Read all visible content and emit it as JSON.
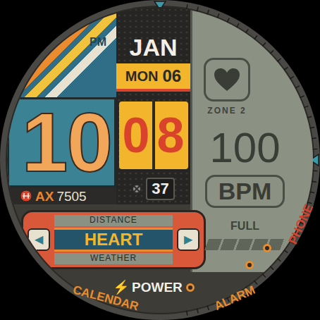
{
  "time": {
    "hours": "10",
    "minutes": "08",
    "seconds": "37",
    "period": "PM"
  },
  "date": {
    "month": "JAN",
    "weekday": "MON",
    "day": "06"
  },
  "brand": {
    "prefix": "AX",
    "model": "7505"
  },
  "heart_rate": {
    "zone": "ZONE 2",
    "value": "100",
    "unit": "BPM"
  },
  "battery": {
    "label": "FULL",
    "level": 1
  },
  "selector": {
    "prev": "◀",
    "next": "▶",
    "items": [
      {
        "label": "DISTANCE",
        "selected": false
      },
      {
        "label": "HEART",
        "selected": true
      },
      {
        "label": "WEATHER",
        "selected": false
      }
    ]
  },
  "power": {
    "icon": "⚡",
    "label": "POWER"
  },
  "shortcuts": [
    {
      "label": "CALENDAR",
      "color": "#e98d2c"
    },
    {
      "label": "ALARM",
      "color": "#e98d2c"
    },
    {
      "label": "PHONE",
      "color": "#d9432b"
    }
  ]
}
